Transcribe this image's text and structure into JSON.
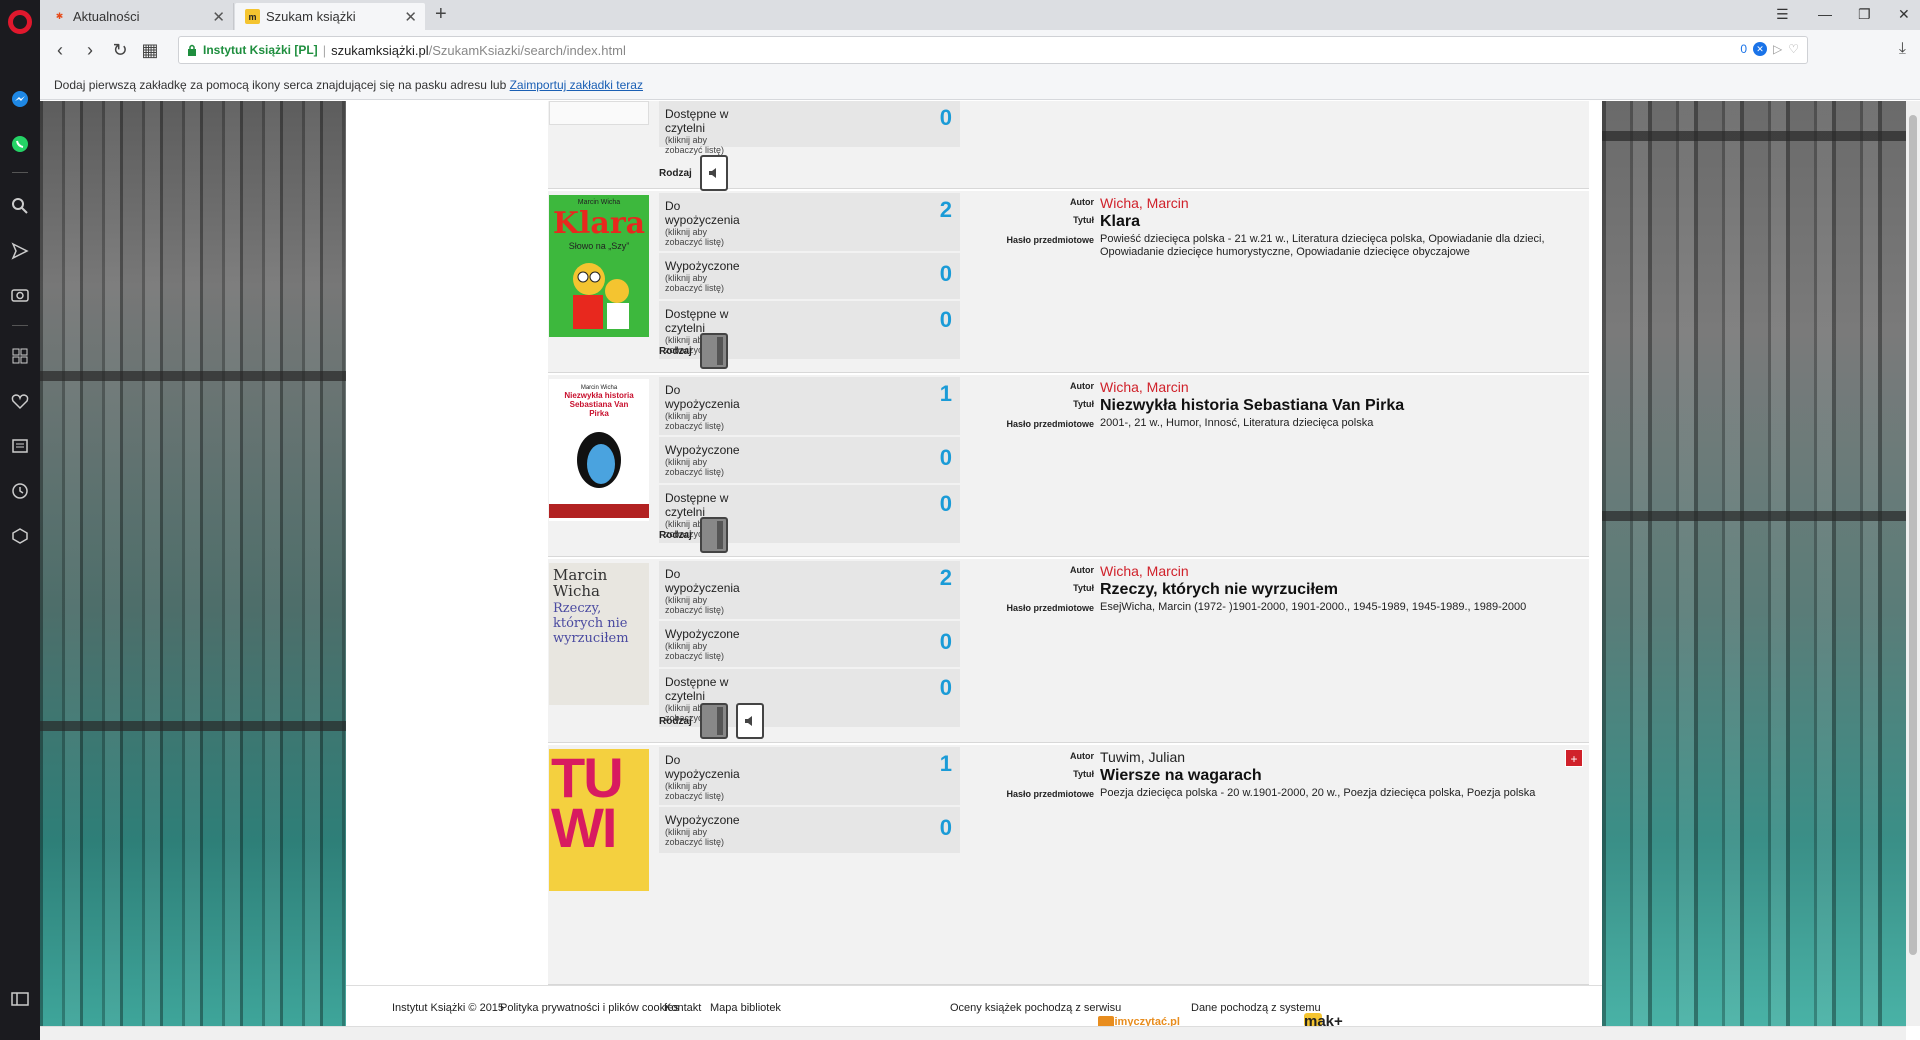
{
  "tabs": [
    {
      "label": "Aktualności",
      "favicon": "joomla-icon"
    },
    {
      "label": "Szukam książki",
      "favicon": "mak-icon"
    }
  ],
  "address": {
    "site_identity": "Instytut Książki [PL]",
    "host": "szukamksiążki.pl",
    "path": "/SzukamKsiazki/search/index.html",
    "badge_count": "0"
  },
  "bookmarks_bar": {
    "text": "Dodaj pierwszą zakładkę za pomocą ikony serca znajdującej się na pasku adresu lub",
    "link": "Zaimportuj zakładki teraz"
  },
  "labels": {
    "available": "Do wypożyczenia",
    "loaned": "Wypożyczone",
    "reading_room": "Dostępne w czytelni",
    "hint": "(kliknij aby zobaczyć listę)",
    "type": "Rodzaj",
    "author_key": "Autor",
    "title_key": "Tytuł",
    "subject_key": "Hasło przedmiotowe"
  },
  "results": [
    {
      "reading_room_count": "0",
      "types": [
        "audiobook"
      ]
    },
    {
      "available_count": "2",
      "loaned_count": "0",
      "reading_room_count": "0",
      "author": "Wicha, Marcin",
      "title": "Klara",
      "subjects": "Powieść dziecięca polska - 21 w.21 w., Literatura dziecięca polska, Opowiadanie dla dzieci, Opowiadanie dziecięce humorystyczne, Opowiadanie dziecięce obyczajowe",
      "cover_title": "Klara",
      "cover_sub": "Słowo na „Szy”",
      "cover_author": "Marcin Wicha",
      "types": [
        "book"
      ]
    },
    {
      "available_count": "1",
      "loaned_count": "0",
      "reading_room_count": "0",
      "author": "Wicha, Marcin",
      "title": "Niezwykła historia Sebastiana Van Pirka",
      "subjects": "2001-, 21 w., Humor, Innosć, Literatura dziecięca polska",
      "cover_title": "Niezwykła historia Sebastiana Van Pirka",
      "cover_author": "Marcin Wicha",
      "types": [
        "book"
      ]
    },
    {
      "available_count": "2",
      "loaned_count": "0",
      "reading_room_count": "0",
      "author": "Wicha, Marcin",
      "title": "Rzeczy, których nie wyrzuciłem",
      "subjects": "EsejWicha, Marcin (1972- )1901-2000, 1901-2000., 1945-1989, 1945-1989., 1989-2000",
      "cover_author": "Marcin Wicha",
      "cover_title": "Rzeczy, których nie wyrzuciłem",
      "types": [
        "book",
        "audiobook"
      ]
    },
    {
      "available_count": "1",
      "loaned_count": "0",
      "author": "Tuwim, Julian",
      "title": "Wiersze na wagarach",
      "subjects": "Poezja dziecięca polska - 20 w.1901-2000, 20 w., Poezja dziecięca polska, Poezja polska",
      "cover_title": "TUWI",
      "add_label": "+"
    }
  ],
  "footer": {
    "copyright": "Instytut Książki © 2015",
    "privacy": "Polityka prywatności i plików cookies",
    "contact": "Kontakt",
    "map": "Mapa bibliotek",
    "ratings": "Oceny książek pochodzą z serwisu",
    "ratings_logo": "lubimyczytać.pl",
    "data_source": "Dane pochodzą z systemu",
    "mak_logo": "mak+"
  },
  "colors": {
    "count": "#1a9bd7",
    "author": "#d0212a",
    "secure": "#1e8e3e"
  }
}
